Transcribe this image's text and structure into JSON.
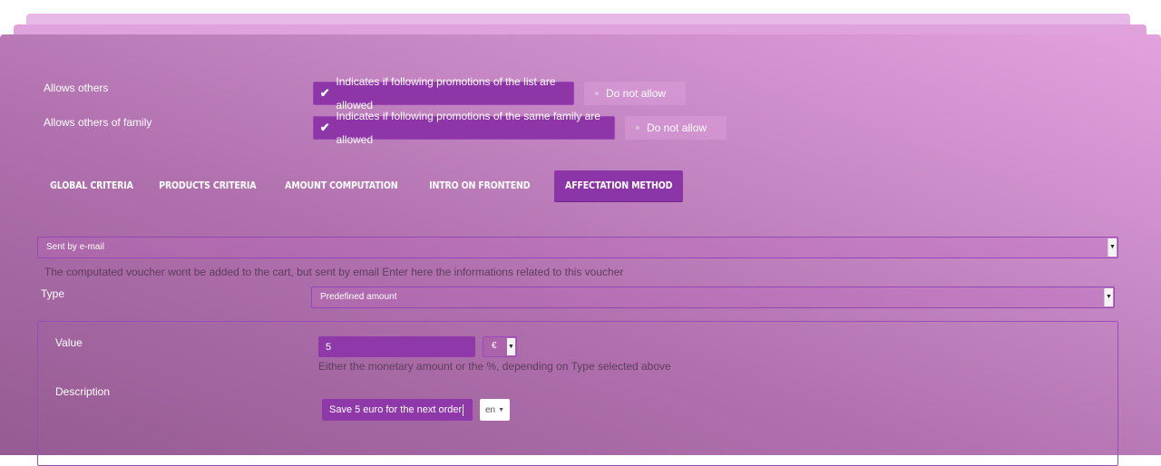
{
  "colors": {
    "accent": "#8e35a8",
    "panel_light": "#e3a2de",
    "panel_dark": "#965b92",
    "help_text": "#5c3d5c"
  },
  "allow_rows": [
    {
      "label": "Allows others",
      "checked_label": "Indicates if following promotions of the list are allowed",
      "unchecked_label": "Do not allow",
      "checked": true
    },
    {
      "label": "Allows others of family",
      "checked_label": "Indicates if following promotions of the same family are allowed",
      "unchecked_label": "Do not allow",
      "checked": true
    }
  ],
  "tabs": [
    {
      "label": "Global criteria",
      "active": false
    },
    {
      "label": "Products criteria",
      "active": false
    },
    {
      "label": "Amount computation",
      "active": false
    },
    {
      "label": "Intro on frontend",
      "active": false
    },
    {
      "label": "Affectation method",
      "active": true
    }
  ],
  "affectation": {
    "method_value": "Sent by e-mail",
    "method_help": "The computated voucher wont be added to the cart, but sent by email Enter here the informations related to this voucher",
    "type_label": "Type",
    "type_value": "Predefined amount",
    "value_label": "Value",
    "value": "5",
    "currency": "€",
    "value_help": "Either the monetary amount or the %, depending on Type selected above",
    "description_label": "Description",
    "description_value": "Save 5 euro for the next order",
    "language": "en"
  },
  "icons": {
    "check": "✔",
    "dropdown": "▼"
  }
}
